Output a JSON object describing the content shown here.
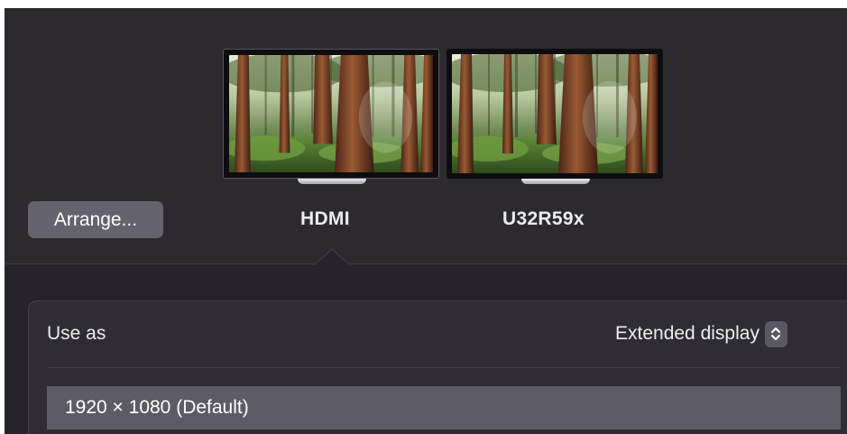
{
  "arrange_button": {
    "label": "Arrange..."
  },
  "displays": [
    {
      "name": "HDMI",
      "selected": true,
      "wallpaper": "sequoia-forest"
    },
    {
      "name": "U32R59x",
      "selected": false,
      "wallpaper": "sequoia-forest"
    }
  ],
  "settings": {
    "use_as_label": "Use as",
    "use_as_value": "Extended display",
    "use_as_icon": "up-down-chevron-icon",
    "resolutions": [
      {
        "label": "1920 × 1080 (Default)",
        "selected": true
      }
    ]
  },
  "colors": {
    "window_background": "#2c2a2f",
    "button_background": "#64626a",
    "selection_background": "#5d5b63",
    "text": "#ececef"
  }
}
